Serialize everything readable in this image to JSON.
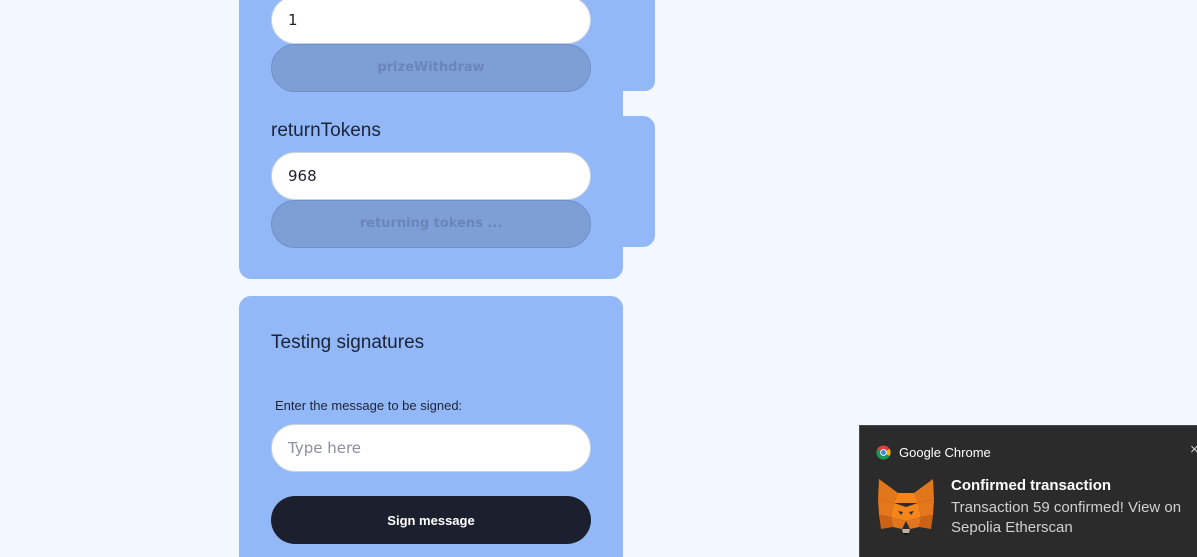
{
  "prize_withdraw": {
    "input_value": "1",
    "button_label": "prizeWithdraw"
  },
  "return_tokens": {
    "heading": "returnTokens",
    "input_value": "968",
    "button_label": "returning tokens ..."
  },
  "signatures": {
    "heading": "Testing signatures",
    "label": "Enter the message to be signed:",
    "placeholder": "Type here",
    "sign_button_label": "Sign message"
  },
  "notification": {
    "app_name": "Google Chrome",
    "app_icon": "chrome-icon",
    "logo_icon": "metamask-fox-icon",
    "close_icon": "close-icon",
    "close_glyph": "×",
    "title": "Confirmed transaction",
    "body": "Transaction 59 confirmed! View on Sepolia Etherscan"
  },
  "colors": {
    "page_background": "#f3f8fe",
    "panel": "#93b8f8",
    "disabled_button": "#7e9fd6",
    "primary_button": "#1b1f2e",
    "notification_background": "#2b2b2b"
  }
}
